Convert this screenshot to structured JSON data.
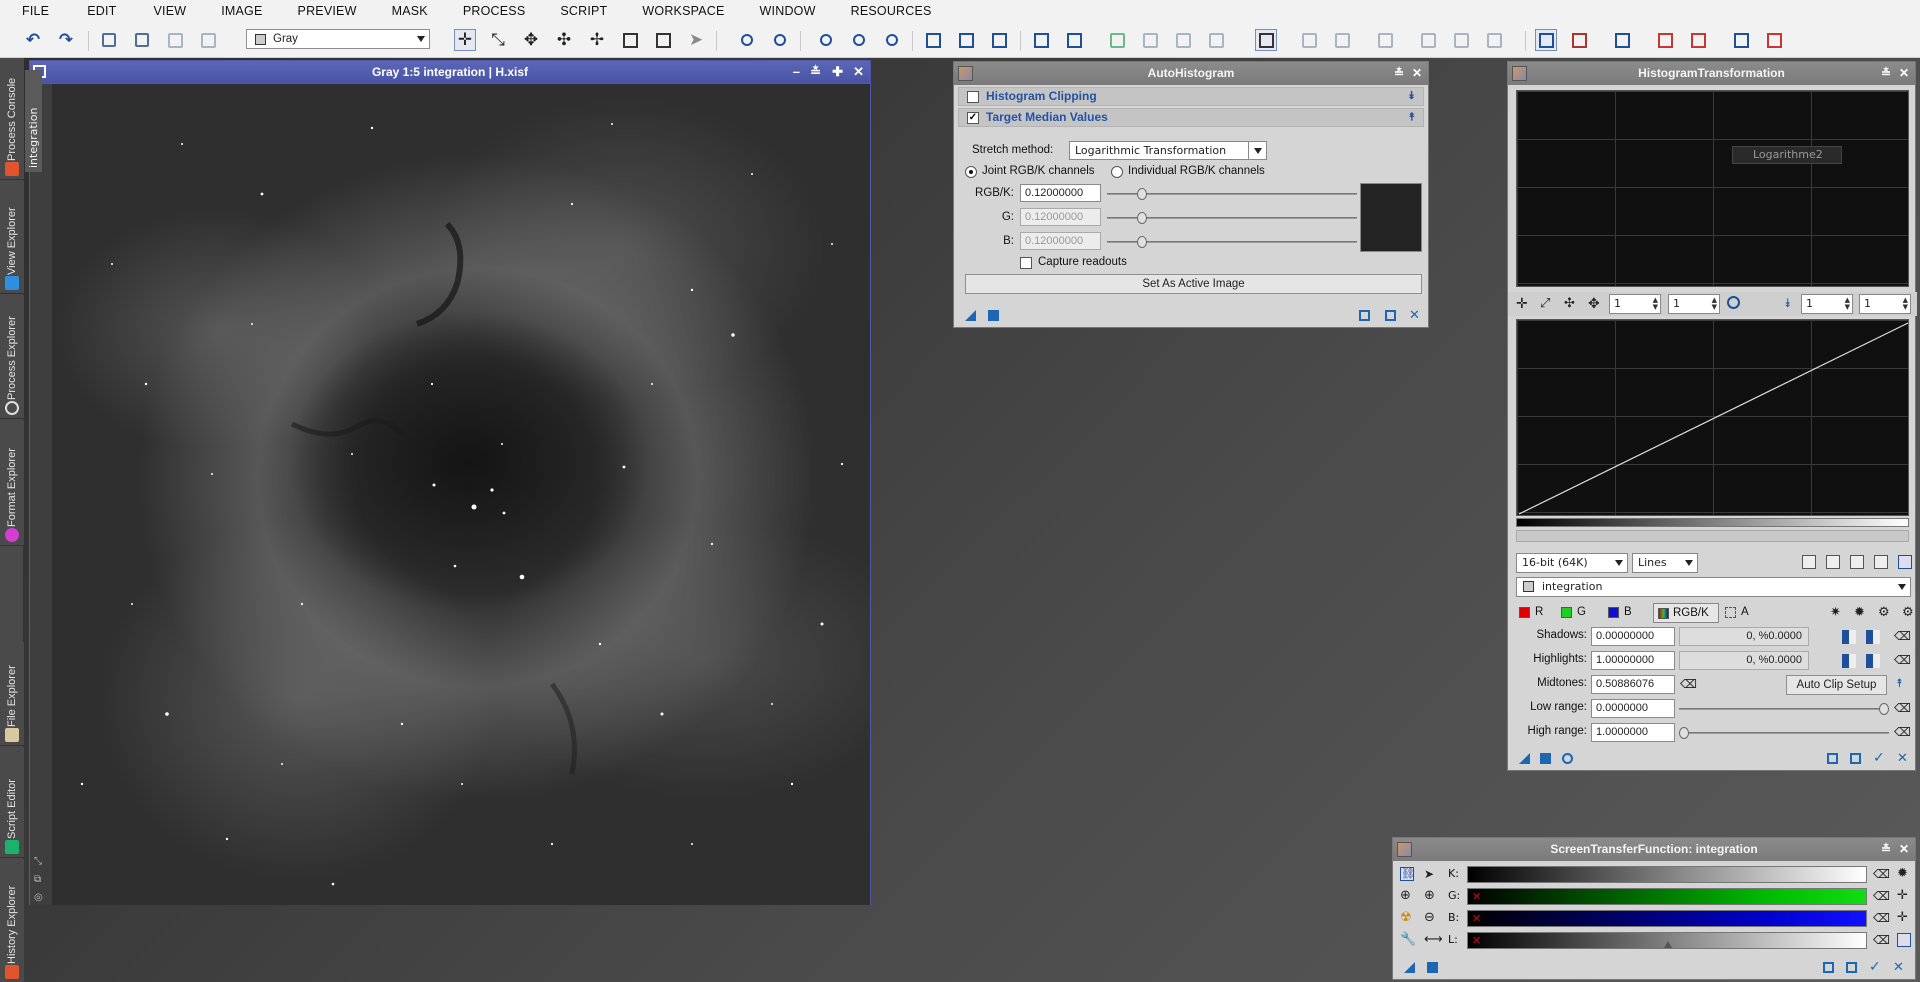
{
  "menu": [
    "FILE",
    "EDIT",
    "VIEW",
    "IMAGE",
    "PREVIEW",
    "MASK",
    "PROCESS",
    "SCRIPT",
    "WORKSPACE",
    "WINDOW",
    "RESOURCES"
  ],
  "toolbar": {
    "gray_select": "Gray"
  },
  "explorers": {
    "process_console": "Process Console",
    "view_explorer": "View Explorer",
    "process_explorer": "Process Explorer",
    "format_explorer": "Format Explorer",
    "file_explorer": "File Explorer",
    "script_editor": "Script Editor",
    "history_explorer": "History Explorer",
    "integration_tab": "integration"
  },
  "image_window": {
    "title": "Gray 1:5 integration | H.xisf"
  },
  "autohist": {
    "title": "AutoHistogram",
    "section_clipping": "Histogram Clipping",
    "section_target": "Target Median Values",
    "stretch_label": "Stretch method:",
    "stretch_value": "Logarithmic Transformation",
    "joint_label": "Joint RGB/K channels",
    "individual_label": "Individual RGB/K channels",
    "rgbk_label": "RGB/K:",
    "rgbk_value": "0.12000000",
    "g_label": "G:",
    "g_value": "0.12000000",
    "b_label": "B:",
    "b_value": "0.12000000",
    "capture_label": "Capture readouts",
    "set_active_label": "Set As Active Image"
  },
  "ht": {
    "title": "HistogramTransformation",
    "overlay_label": "Logarithme2",
    "zoom_x1": "1",
    "zoom_y1": "1",
    "zoom_x2": "1",
    "zoom_y2": "1",
    "resolution": "16-bit (64K)",
    "graph_style": "Lines",
    "view": "integration",
    "ch_r": "R",
    "ch_g": "G",
    "ch_b": "B",
    "ch_rgbk": "RGB/K",
    "ch_a": "A",
    "shadows_label": "Shadows:",
    "shadows_value": "0.00000000",
    "shadows_clip": "0, %0.0000",
    "highlights_label": "Highlights:",
    "highlights_value": "1.00000000",
    "highlights_clip": "0, %0.0000",
    "midtones_label": "Midtones:",
    "midtones_value": "0.50886076",
    "auto_clip_label": "Auto Clip Setup",
    "lowrange_label": "Low range:",
    "lowrange_value": "0.0000000",
    "highrange_label": "High range:",
    "highrange_value": "1.0000000"
  },
  "stf": {
    "title": "ScreenTransferFunction: integration",
    "k_label": "K:",
    "g_label": "G:",
    "b_label": "B:",
    "l_label": "L:"
  }
}
